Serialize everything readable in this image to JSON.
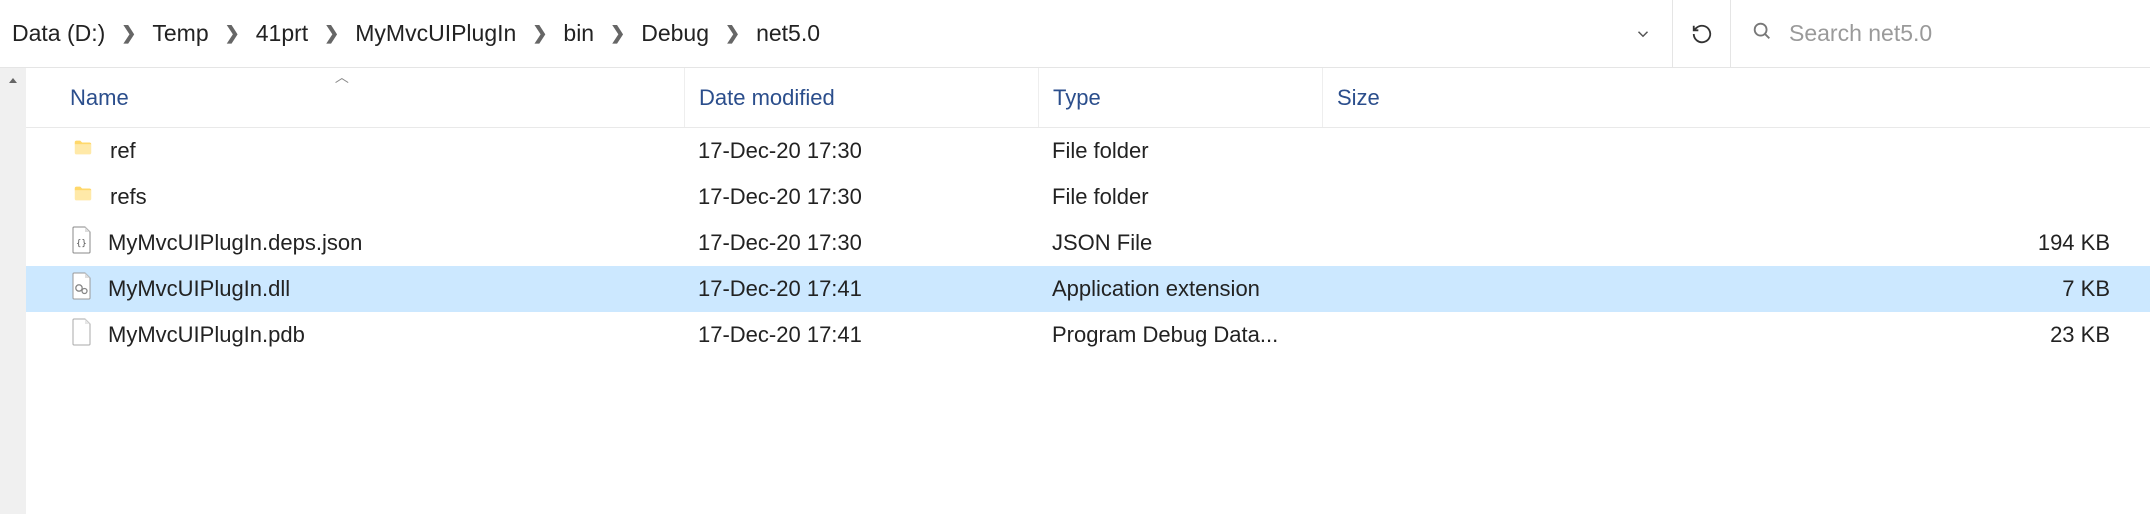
{
  "breadcrumb": {
    "items": [
      {
        "label": "Data (D:)"
      },
      {
        "label": "Temp"
      },
      {
        "label": "41prt"
      },
      {
        "label": "MyMvcUIPlugIn"
      },
      {
        "label": "bin"
      },
      {
        "label": "Debug"
      },
      {
        "label": "net5.0"
      }
    ]
  },
  "search": {
    "placeholder": "Search net5.0"
  },
  "columns": {
    "name": "Name",
    "date": "Date modified",
    "type": "Type",
    "size": "Size"
  },
  "files": [
    {
      "icon": "folder",
      "name": "ref",
      "date": "17-Dec-20 17:30",
      "type": "File folder",
      "size": ""
    },
    {
      "icon": "folder",
      "name": "refs",
      "date": "17-Dec-20 17:30",
      "type": "File folder",
      "size": ""
    },
    {
      "icon": "json",
      "name": "MyMvcUIPlugIn.deps.json",
      "date": "17-Dec-20 17:30",
      "type": "JSON File",
      "size": "194 KB"
    },
    {
      "icon": "dll",
      "name": "MyMvcUIPlugIn.dll",
      "date": "17-Dec-20 17:41",
      "type": "Application extension",
      "size": "7 KB",
      "selected": true
    },
    {
      "icon": "pdb",
      "name": "MyMvcUIPlugIn.pdb",
      "date": "17-Dec-20 17:41",
      "type": "Program Debug Data...",
      "size": "23 KB"
    }
  ]
}
